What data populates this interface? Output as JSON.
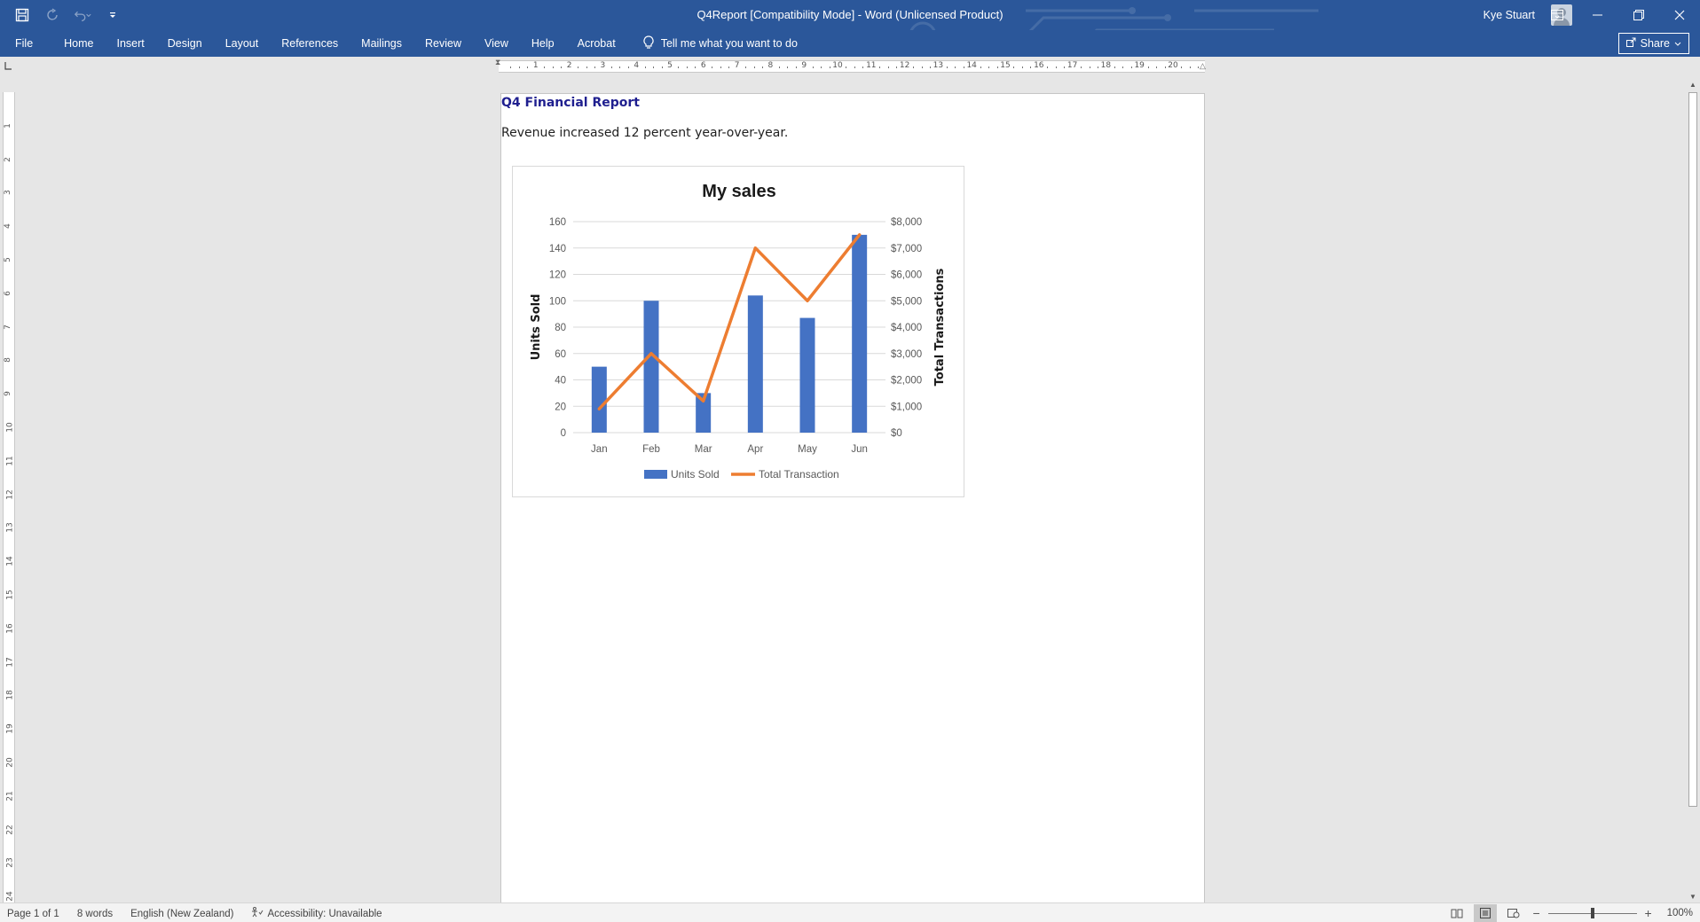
{
  "window": {
    "title": "Q4Report [Compatibility Mode]  -  Word (Unlicensed Product)",
    "user": "Kye Stuart",
    "accent": "#2b579a"
  },
  "qat": {
    "save_icon": "save-icon",
    "redo_icon": "redo-icon",
    "undo_icon": "undo-icon",
    "customize_icon": "customize-icon"
  },
  "ribbon": {
    "tabs": [
      "File",
      "Home",
      "Insert",
      "Design",
      "Layout",
      "References",
      "Mailings",
      "Review",
      "View",
      "Help",
      "Acrobat"
    ],
    "tell_me": "Tell me what you want to do",
    "share": "Share"
  },
  "document": {
    "heading": "Q4 Financial Report",
    "paragraph": "Revenue increased 12 percent year-over-year."
  },
  "chart_data": {
    "type": "bar",
    "title": "My sales",
    "categories": [
      "Jan",
      "Feb",
      "Mar",
      "Apr",
      "May",
      "Jun"
    ],
    "series": [
      {
        "name": "Units Sold",
        "type": "bar",
        "axis": "left",
        "color": "#4472c4",
        "values": [
          50,
          100,
          30,
          104,
          87,
          150
        ]
      },
      {
        "name": "Total Transaction",
        "type": "line",
        "axis": "right",
        "color": "#ed7d31",
        "values": [
          900,
          3000,
          1200,
          7000,
          5000,
          7500
        ]
      }
    ],
    "ylabel": "Units Sold",
    "ylim": [
      0,
      160
    ],
    "yticks": [
      "0",
      "20",
      "40",
      "60",
      "80",
      "100",
      "120",
      "140",
      "160"
    ],
    "y2label": "Total Transactions",
    "y2lim": [
      0,
      8000
    ],
    "y2ticks": [
      "$0",
      "$1,000",
      "$2,000",
      "$3,000",
      "$4,000",
      "$5,000",
      "$6,000",
      "$7,000",
      "$8,000"
    ],
    "grid": true,
    "legend_position": "bottom"
  },
  "status": {
    "page": "Page 1 of 1",
    "words": "8 words",
    "language": "English (New Zealand)",
    "accessibility": "Accessibility: Unavailable",
    "zoom": "100%",
    "zoom_fraction": 0.5
  }
}
